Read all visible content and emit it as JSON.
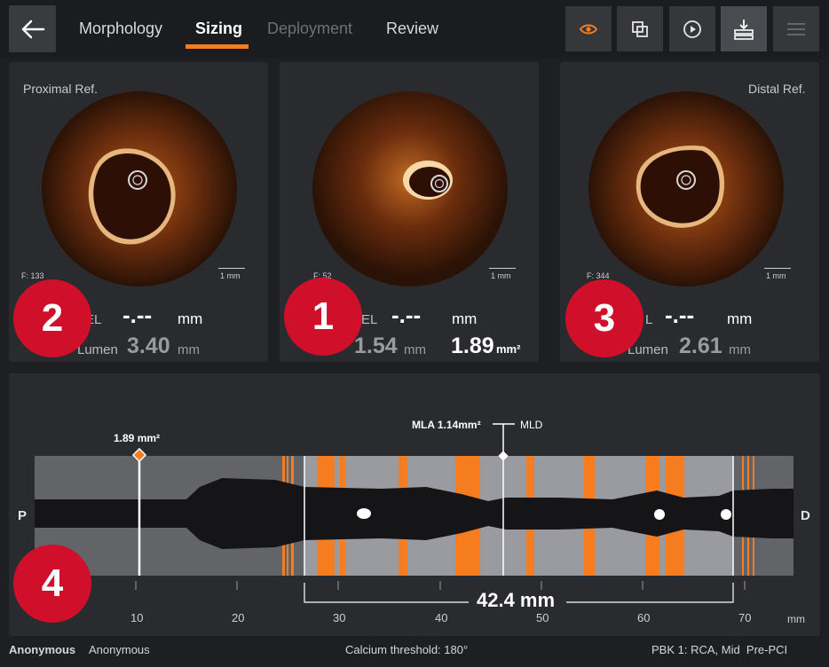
{
  "header": {
    "tabs": [
      "Morphology",
      "Sizing",
      "Deployment",
      "Review"
    ]
  },
  "panels": {
    "proximal": {
      "title": "Proximal Ref.",
      "frame": "F: 133",
      "scale": "1 mm",
      "el_label": "EL",
      "el_value": "-.--",
      "el_unit": "mm",
      "lumen_label": "Lumen",
      "lumen_value": "3.40",
      "lumen_unit": "mm"
    },
    "mla": {
      "frame": "F: 52",
      "scale": "1 mm",
      "el_label": "EL",
      "el_value": "-.--",
      "el_unit": "mm",
      "lumen_value": "1.54",
      "lumen_unit": "mm",
      "area_value": "1.89",
      "area_unit": "mm²"
    },
    "distal": {
      "title": "Distal Ref.",
      "frame": "F: 344",
      "scale": "1 mm",
      "el_label": "L",
      "el_value": "-.--",
      "el_unit": "mm",
      "lumen_label": "Lumen",
      "lumen_value": "2.61",
      "lumen_unit": "mm"
    }
  },
  "badges": [
    "2",
    "1",
    "3",
    "4"
  ],
  "longitudinal": {
    "marker_area": "1.89 mm²",
    "mla_label": "MLA 1.14mm²",
    "mld_label": "MLD",
    "left_end": "P",
    "right_end": "D",
    "length": "42.4 mm",
    "axis_ticks": [
      "10",
      "20",
      "30",
      "40",
      "50",
      "60",
      "70"
    ],
    "axis_unit": "mm"
  },
  "footer": {
    "patient_name": "Anonymous",
    "patient_id": "Anonymous",
    "calcium": "Calcium threshold: 180°",
    "procedure": "PBK 1: RCA, Mid  Pre-PCI"
  },
  "colors": {
    "accent": "#f57c1f",
    "badge": "#d0102b"
  }
}
